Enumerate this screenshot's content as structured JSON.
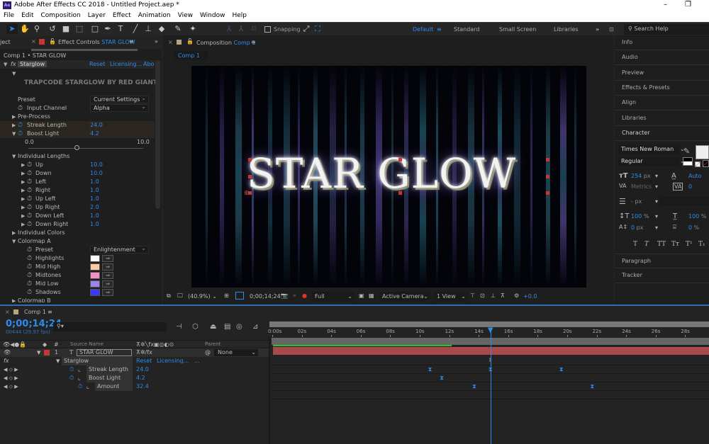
{
  "app": {
    "title": "Adobe After Effects CC 2018 - Untitled Project.aep *",
    "logo": "Ae"
  },
  "window_controls": [
    "minimize-icon",
    "restore-icon"
  ],
  "menu": [
    "File",
    "Edit",
    "Composition",
    "Layer",
    "Effect",
    "Animation",
    "View",
    "Window",
    "Help"
  ],
  "toolbar": {
    "tools": [
      "selection-tool",
      "hand-tool",
      "zoom-tool",
      "rotation-tool",
      "camera-tool",
      "pan-behind-tool",
      "rectangle-tool",
      "pen-tool",
      "type-tool",
      "brush-tool",
      "clone-stamp-tool",
      "eraser-tool",
      "roto-brush-tool",
      "puppet-pin-tool"
    ],
    "snapping_label": "Snapping",
    "workspaces": [
      "Default",
      "Standard",
      "Small Screen",
      "Libraries"
    ],
    "active_workspace": "Default",
    "search_placeholder": "Search Help"
  },
  "effect_controls": {
    "left_tab": "ject",
    "tab_prefix": "Effect Controls",
    "tab_layer": "STAR GLOW",
    "breadcrumb": "Comp 1 • STAR GLOW",
    "effect_name": "Starglow",
    "links": [
      "Reset",
      "Licensing...",
      "Abo"
    ],
    "banner": "TRAPCODE STARGLOW BY RED GIANT",
    "preset_label": "Preset",
    "preset_value": "Current Settings",
    "input_channel_label": "Input Channel",
    "input_channel_value": "Alpha",
    "pre_process": "Pre-Process",
    "streak_length": {
      "label": "Streak Length",
      "value": "24.0"
    },
    "boost_light": {
      "label": "Boost Light",
      "value": "4.2",
      "slider_min": "0.0",
      "slider_max": "10.0",
      "slider_fraction": 0.42
    },
    "individual_lengths": {
      "label": "Individual Lengths",
      "items": [
        {
          "label": "Up",
          "value": "10.0"
        },
        {
          "label": "Down",
          "value": "10.0"
        },
        {
          "label": "Left",
          "value": "1.0"
        },
        {
          "label": "Right",
          "value": "1.0"
        },
        {
          "label": "Up Left",
          "value": "1.0"
        },
        {
          "label": "Up Right",
          "value": "2.0"
        },
        {
          "label": "Down Left",
          "value": "1.0"
        },
        {
          "label": "Down Right",
          "value": "1.0"
        }
      ]
    },
    "individual_colors": "Individual Colors",
    "colormap_a": {
      "label": "Colormap A",
      "preset_label": "Preset",
      "preset_value": "Enlightenment",
      "colors": [
        {
          "label": "Highlights",
          "color": "#ffffff"
        },
        {
          "label": "Mid High",
          "color": "#ffc9a0"
        },
        {
          "label": "Midtones",
          "color": "#f490c8"
        },
        {
          "label": "Mid Low",
          "color": "#9a84f0"
        },
        {
          "label": "Shadows",
          "color": "#3a3aff"
        }
      ]
    },
    "colormap_b": "Colormap B"
  },
  "composition": {
    "tab_prefix": "Composition",
    "tab_name": "Comp 1",
    "sub_tab": "Comp 1",
    "viewer_text": "STAR GLOW",
    "zoom": "(40.9%)",
    "timecode": "0;00;14;24",
    "resolution": "Full",
    "camera": "Active Camera",
    "views": "1 View",
    "exposure": "+0.0"
  },
  "right_panel": {
    "items": [
      "Info",
      "Audio",
      "Preview",
      "Effects & Presets",
      "Align",
      "Libraries",
      "Character"
    ],
    "character": {
      "font": "Times New Roman",
      "style": "Regular",
      "size": "254",
      "size_unit": "px",
      "leading": "Auto",
      "kerning": "Metrics",
      "tracking": "0",
      "stroke_width": "-",
      "stroke_unit": "px",
      "vertical_scale": "100",
      "horizontal_scale": "100",
      "baseline_shift": "0",
      "tsume": "0",
      "percent": "%",
      "style_buttons": [
        "T",
        "T",
        "TT",
        "Tт",
        "T¹",
        "T₁"
      ]
    },
    "bottom_items": [
      "Paragraph",
      "Tracker"
    ]
  },
  "timeline": {
    "tab": "Comp 1",
    "timecode": "0;00;14;24",
    "frame_info": "00444 (29.97 fps)",
    "search_placeholder": "",
    "columns": {
      "hash": "#",
      "source_name": "Source Name",
      "parent": "Parent"
    },
    "layer": {
      "number": "1",
      "type": "T",
      "name": "STAR GLOW",
      "parent": "None",
      "label_color": "#c0373a"
    },
    "effect": {
      "name": "Starglow",
      "links": [
        "Reset",
        "Licensing...",
        "..."
      ]
    },
    "properties": [
      {
        "name": "Streak Length",
        "value": "24.0",
        "keyframes_sec": [
          10.7,
          14.8,
          19.6
        ]
      },
      {
        "name": "Boost Light",
        "value": "4.2",
        "keyframes_sec": [
          11.5
        ]
      },
      {
        "name": "Amount",
        "value": "32.4",
        "keyframes_sec": [
          13.7,
          21.7
        ]
      }
    ],
    "ruler_labels": [
      "0:00s",
      "02s",
      "04s",
      "06s",
      "08s",
      "10s",
      "12s",
      "14s",
      "16s",
      "18s",
      "20s",
      "22s",
      "24s",
      "26s",
      "28s"
    ],
    "current_time_sec": 14.8,
    "render_bar_fraction": 0.41
  }
}
